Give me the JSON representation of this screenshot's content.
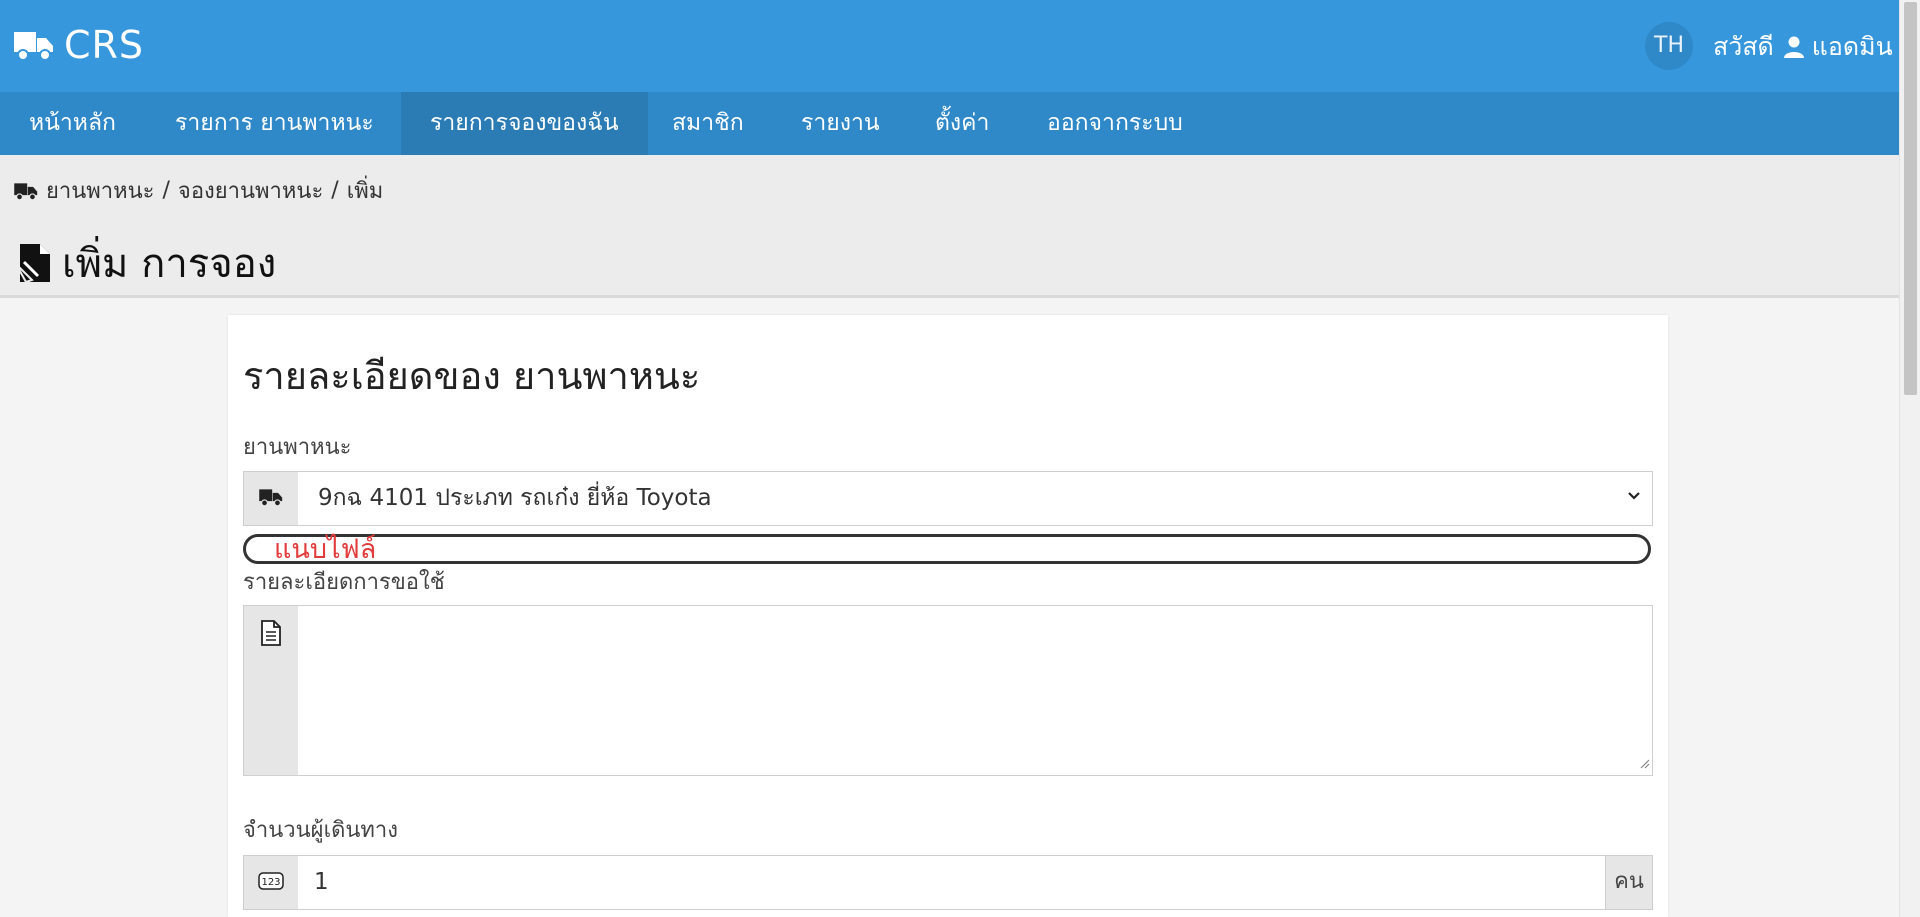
{
  "topbar": {
    "brand": "CRS",
    "language": "TH",
    "greeting": "สวัสดี",
    "username": "แอดมิน",
    "bg_color": "#3697dd"
  },
  "nav": {
    "items": [
      {
        "label": "หน้าหลัก"
      },
      {
        "label": "รายการ ยานพาหนะ"
      },
      {
        "label": "รายการจองของฉัน"
      },
      {
        "label": "สมาชิก"
      },
      {
        "label": "รายงาน"
      },
      {
        "label": "ตั้งค่า"
      },
      {
        "label": "ออกจากระบบ"
      }
    ],
    "active": "รายการจองของฉัน"
  },
  "breadcrumb": {
    "items": [
      "ยานพาหนะ",
      "จองยานพาหนะ",
      "เพิ่ม"
    ],
    "separator": "/"
  },
  "page": {
    "title": "เพิ่ม การจอง"
  },
  "form": {
    "section_title": "รายละเอียดของ ยานพาหนะ",
    "vehicle": {
      "label": "ยานพาหนะ",
      "selected": "9กฉ 4101 ประเภท รถเก๋ง ยี่ห้อ Toyota"
    },
    "attachment": {
      "label": "แนบไฟล์"
    },
    "detail": {
      "label": "รายละเอียดการขอใช้",
      "value": ""
    },
    "passengers": {
      "label": "จำนวนผู้เดินทาง",
      "value": "1",
      "unit": "คน"
    }
  },
  "icons": [
    "truck-icon",
    "user-icon",
    "doc-edit-icon",
    "file-text-icon",
    "number-icon",
    "chevron-down-icon"
  ]
}
